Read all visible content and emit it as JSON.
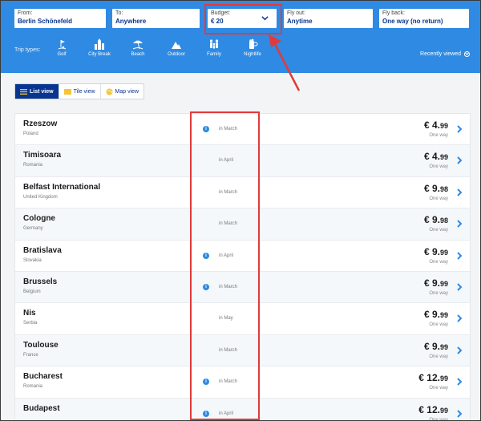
{
  "search": {
    "from": {
      "label": "From:",
      "value": "Berlin Schönefeld"
    },
    "to": {
      "label": "To:",
      "value": "Anywhere"
    },
    "budget": {
      "label": "Budget:",
      "value": "€ 20"
    },
    "fly_out": {
      "label": "Fly out:",
      "value": "Anytime"
    },
    "fly_back": {
      "label": "Fly back:",
      "value": "One way (no return)"
    }
  },
  "trip_types": {
    "label": "Trip types:",
    "items": [
      {
        "label": "Golf",
        "icon": "golf-icon"
      },
      {
        "label": "City Break",
        "icon": "city-icon"
      },
      {
        "label": "Beach",
        "icon": "beach-icon"
      },
      {
        "label": "Outdoor",
        "icon": "mountain-icon"
      },
      {
        "label": "Family",
        "icon": "family-icon"
      },
      {
        "label": "Nightlife",
        "icon": "drink-icon"
      }
    ]
  },
  "recently_viewed": "Recently viewed",
  "views": {
    "list": "List view",
    "tile": "Tile view",
    "map": "Map view"
  },
  "results": [
    {
      "city": "Rzeszow",
      "country": "Poland",
      "info": true,
      "month": "in March",
      "price_main": "€ 4.",
      "price_cents": "99",
      "type": "One way"
    },
    {
      "city": "Timisoara",
      "country": "Romania",
      "info": false,
      "month": "in April",
      "price_main": "€ 4.",
      "price_cents": "99",
      "type": "One way"
    },
    {
      "city": "Belfast International",
      "country": "United Kingdom",
      "info": false,
      "month": "in March",
      "price_main": "€ 9.",
      "price_cents": "98",
      "type": "One way"
    },
    {
      "city": "Cologne",
      "country": "Germany",
      "info": false,
      "month": "in March",
      "price_main": "€ 9.",
      "price_cents": "98",
      "type": "One way"
    },
    {
      "city": "Bratislava",
      "country": "Slovakia",
      "info": true,
      "month": "in April",
      "price_main": "€ 9.",
      "price_cents": "99",
      "type": "One way"
    },
    {
      "city": "Brussels",
      "country": "Belgium",
      "info": true,
      "month": "in March",
      "price_main": "€ 9.",
      "price_cents": "99",
      "type": "One way"
    },
    {
      "city": "Nis",
      "country": "Serbia",
      "info": false,
      "month": "in May",
      "price_main": "€ 9.",
      "price_cents": "99",
      "type": "One way"
    },
    {
      "city": "Toulouse",
      "country": "France",
      "info": false,
      "month": "in March",
      "price_main": "€ 9.",
      "price_cents": "99",
      "type": "One way"
    },
    {
      "city": "Bucharest",
      "country": "Romania",
      "info": true,
      "month": "in March",
      "price_main": "€ 12.",
      "price_cents": "99",
      "type": "One way"
    },
    {
      "city": "Budapest",
      "country": "",
      "info": true,
      "month": "in April",
      "price_main": "€ 12.",
      "price_cents": "99",
      "type": "One way"
    }
  ],
  "colors": {
    "header_blue": "#2f8ae3",
    "brand_navy": "#073590",
    "annotation_red": "#e23a3a"
  }
}
